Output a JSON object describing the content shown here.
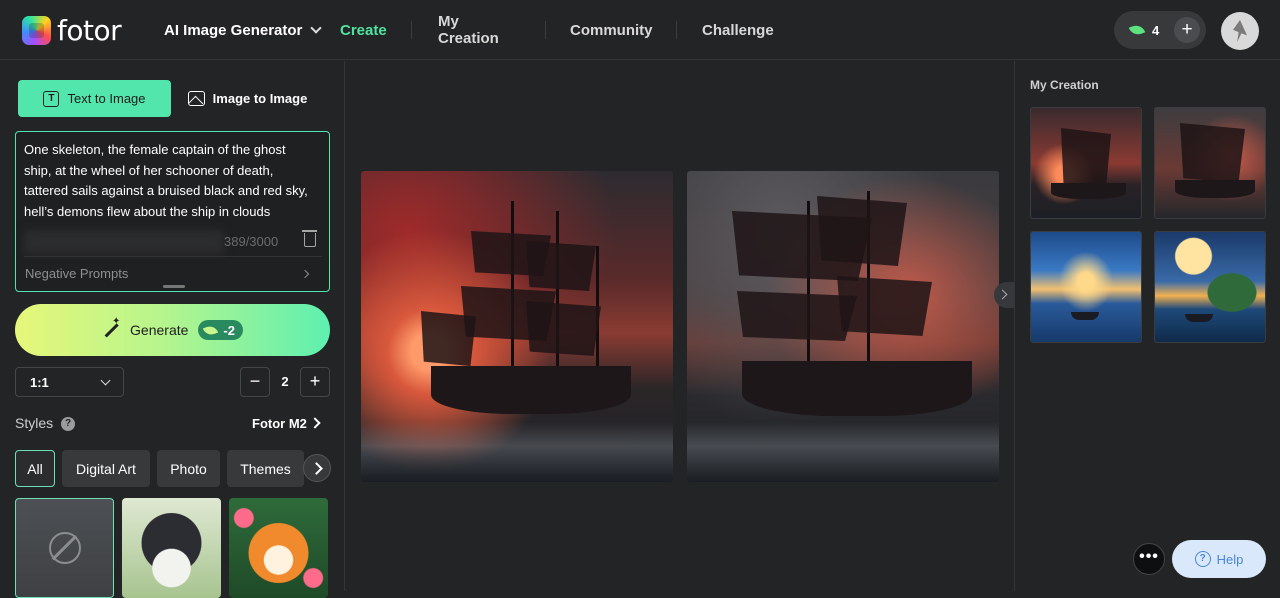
{
  "header": {
    "logo_text": "fotor",
    "nav": {
      "generator": "AI Image Generator",
      "create": "Create",
      "my_creation": "My Creation",
      "community": "Community",
      "challenge": "Challenge"
    },
    "credits": "4",
    "credits_add": "+",
    "accent_color": "#4fe3a0"
  },
  "left_panel": {
    "tabs": {
      "text_to_image": "Text to Image",
      "image_to_image": "Image to Image",
      "text_icon_glyph": "T"
    },
    "prompt": {
      "text": "One skeleton, the female captain of the ghost ship, at the wheel of her schooner of death, tattered sails against a bruised black and red sky, hell’s demons flew about the ship in clouds",
      "char_count": "389/3000"
    },
    "negative_prompts_label": "Negative Prompts",
    "generate": {
      "label": "Generate",
      "cost": "-2"
    },
    "ratio": {
      "selected": "1:1"
    },
    "quantity": {
      "minus": "−",
      "value": "2",
      "plus": "+"
    },
    "styles": {
      "label": "Styles",
      "help_glyph": "?",
      "model": "Fotor M2",
      "chips": [
        "All",
        "Digital Art",
        "Photo",
        "Themes"
      ]
    }
  },
  "right_panel": {
    "title": "My Creation"
  },
  "floating": {
    "more": "•••",
    "help": "Help",
    "help_glyph": "?"
  }
}
